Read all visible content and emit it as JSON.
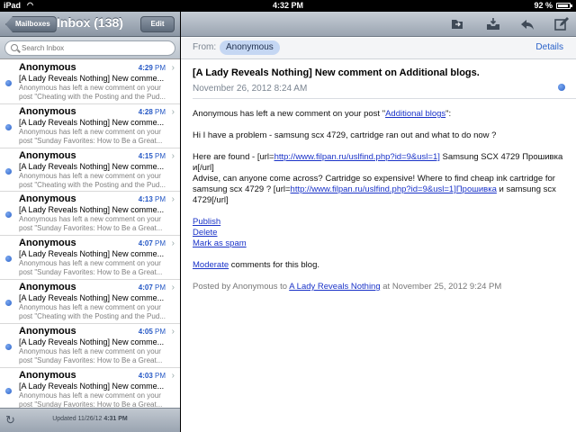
{
  "status": {
    "carrier": "iPad",
    "time": "4:32 PM",
    "battery": "92 %",
    "battery_level": 0.92
  },
  "left": {
    "back_label": "Mailboxes",
    "title": "Inbox (138)",
    "edit_label": "Edit",
    "search_placeholder": "Search Inbox",
    "messages": [
      {
        "sender": "Anonymous",
        "time": "4:29",
        "ampm": "PM",
        "subject": "[A Lady Reveals Nothing] New comme...",
        "preview": "Anonymous has left a new comment on your post \"Cheating with the Posting and the Pud..."
      },
      {
        "sender": "Anonymous",
        "time": "4:28",
        "ampm": "PM",
        "subject": "[A Lady Reveals Nothing] New comme...",
        "preview": "Anonymous has left a new comment on your post \"Sunday Favorites: How to Be a Great..."
      },
      {
        "sender": "Anonymous",
        "time": "4:15",
        "ampm": "PM",
        "subject": "[A Lady Reveals Nothing] New comme...",
        "preview": "Anonymous has left a new comment on your post \"Cheating with the Posting and the Pud..."
      },
      {
        "sender": "Anonymous",
        "time": "4:13",
        "ampm": "PM",
        "subject": "[A Lady Reveals Nothing] New comme...",
        "preview": "Anonymous has left a new comment on your post \"Sunday Favorites: How to Be a Great..."
      },
      {
        "sender": "Anonymous",
        "time": "4:07",
        "ampm": "PM",
        "subject": "[A Lady Reveals Nothing] New comme...",
        "preview": "Anonymous has left a new comment on your post \"Sunday Favorites: How to Be a Great..."
      },
      {
        "sender": "Anonymous",
        "time": "4:07",
        "ampm": "PM",
        "subject": "[A Lady Reveals Nothing] New comme...",
        "preview": "Anonymous has left a new comment on your post \"Cheating with the Posting and the Pud..."
      },
      {
        "sender": "Anonymous",
        "time": "4:05",
        "ampm": "PM",
        "subject": "[A Lady Reveals Nothing] New comme...",
        "preview": "Anonymous has left a new comment on your post \"Sunday Favorites: How to Be a Great..."
      },
      {
        "sender": "Anonymous",
        "time": "4:03",
        "ampm": "PM",
        "subject": "[A Lady Reveals Nothing] New comme...",
        "preview": "Anonymous has left a new comment on your post \"Sunday Favorites: How to Be a Great..."
      }
    ],
    "updated_label": "Updated",
    "updated_date": "11/26/12",
    "updated_time": "4:31 PM"
  },
  "message": {
    "from_label": "From:",
    "from_name": "Anonymous",
    "details_label": "Details",
    "subject": "[A Lady Reveals Nothing] New comment on Additional blogs.",
    "date": "November 26, 2012 8:24 AM",
    "p1_pre": "Anonymous has left a new comment on your post \"",
    "p1_link": "Additional blogs",
    "p1_post": "\":",
    "p2": "Hi I have a problem - samsung scx 4729, cartridge ran out and what to do now ?",
    "p3_a": "Here are found - [url=",
    "p3_link1": "http://www.filpan.ru/uslfind.php?id=9&usl=1]",
    "p3_b": " Samsung SCX 4729 Прошивка и[/url]",
    "p3_c": "Advise, can anyone come across? Cartridge so expensive! Where to find cheap ink cartridge for samsung scx 4729 ? [url=",
    "p3_link2": "http://www.filpan.ru/uslfind.php?id=9&usl=1]Прошивка",
    "p3_d": " и samsung scx 4729[/url]",
    "publish": "Publish",
    "delete": "Delete",
    "spam": "Mark as spam",
    "moderate": "Moderate",
    "moderate_post": " comments for this blog.",
    "posted_pre": "Posted by Anonymous to ",
    "posted_link": "A Lady Reveals Nothing",
    "posted_post": " at November 25, 2012 9:24 PM"
  },
  "icons": [
    "wifi-icon",
    "battery-icon",
    "search-icon",
    "chevron-right-icon",
    "refresh-icon",
    "move-folder-icon",
    "archive-icon",
    "reply-icon",
    "compose-icon"
  ],
  "colors": {
    "accent": "#2457c5",
    "link": "#1a33c8",
    "toolbar": "#9aa4b1"
  }
}
